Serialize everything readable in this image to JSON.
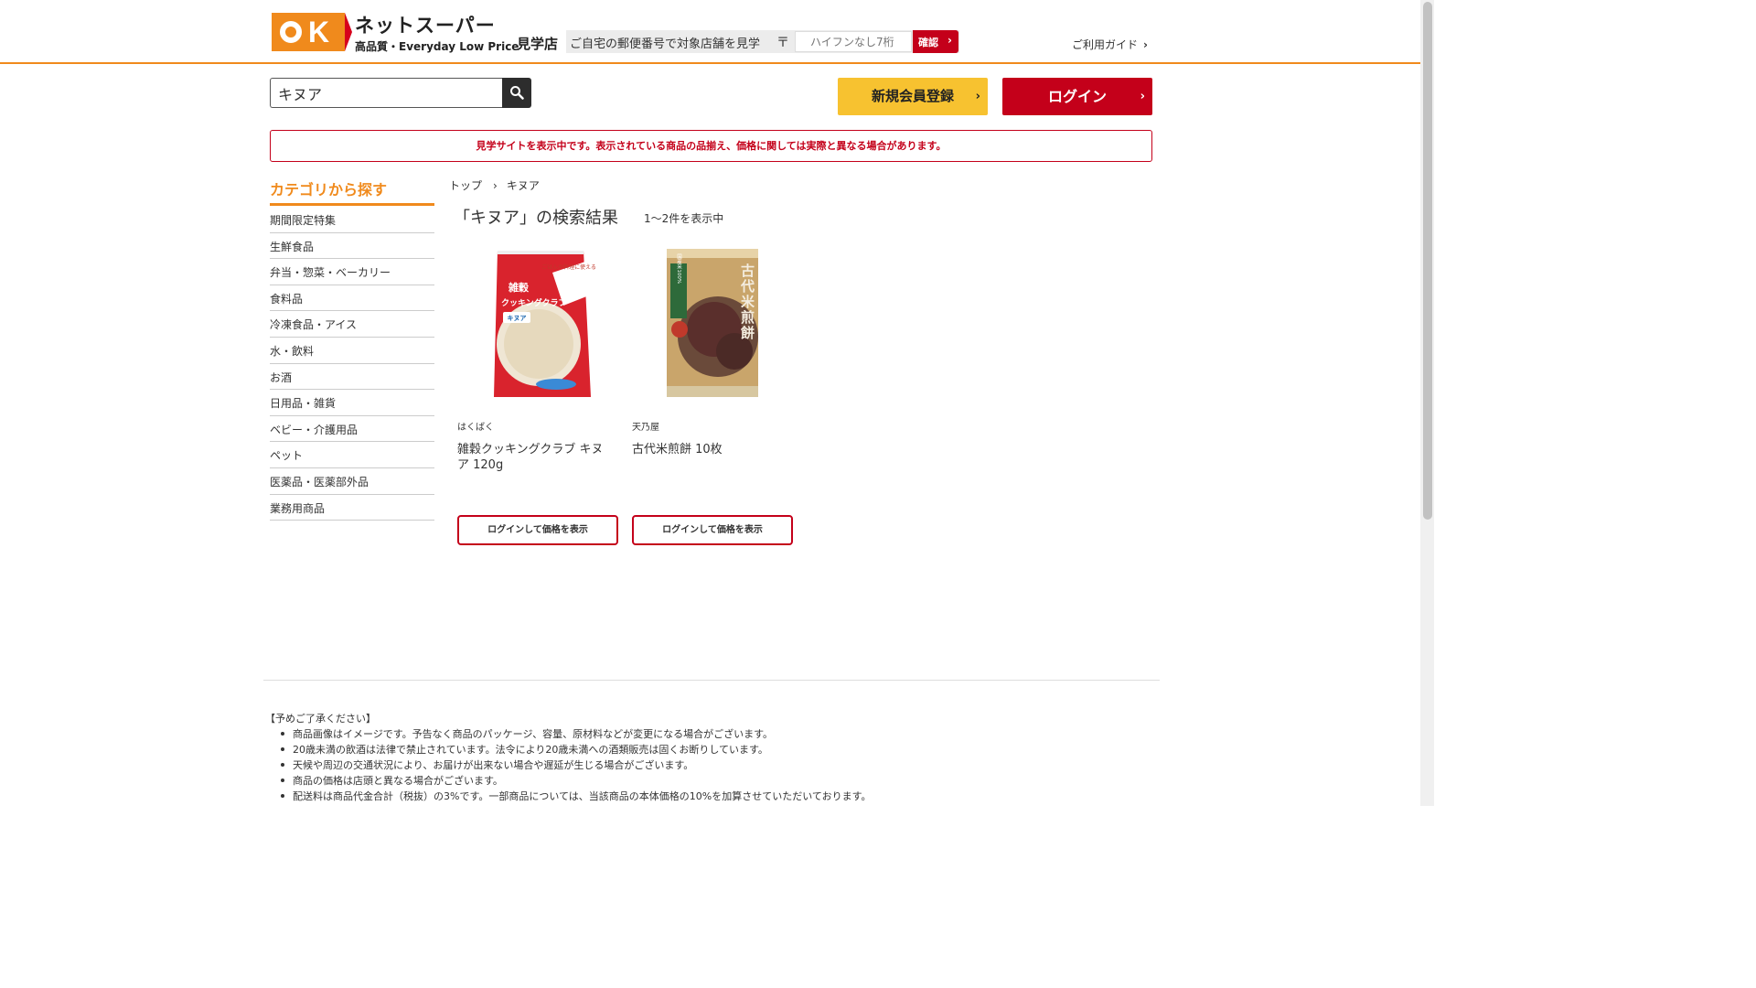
{
  "header": {
    "brand_title": "ネットスーパー",
    "brand_sub": "高品質・Everyday Low Price",
    "store_label": "見学店",
    "zip_prompt": "ご自宅の郵便番号で対象店舗を見学",
    "zip_mark": "〒",
    "zip_placeholder": "ハイフンなし7桁",
    "zip_button": "確認",
    "guide_link": "ご利用ガイド"
  },
  "search": {
    "value": "キヌア"
  },
  "buttons": {
    "register": "新規会員登録",
    "login": "ログイン"
  },
  "notice": "見学サイトを表示中です。表示されている商品の品揃え、価格に関しては実際と異なる場合があります。",
  "sidebar": {
    "title": "カテゴリから探す",
    "items": [
      "期間限定特集",
      "生鮮食品",
      "弁当・惣菜・ベーカリー",
      "食料品",
      "冷凍食品・アイス",
      "水・飲料",
      "お酒",
      "日用品・雑貨",
      "ベビー・介護用品",
      "ペット",
      "医薬品・医薬部外品",
      "業務用商品"
    ]
  },
  "breadcrumb": {
    "home": "トップ",
    "sep": "›",
    "current": "キヌア"
  },
  "results": {
    "title": "「キヌア」の検索結果",
    "count": "1〜2件を表示中"
  },
  "products": [
    {
      "maker": "はくばく",
      "name": "雑穀クッキングクラブ キヌア 120g",
      "price_button": "ログインして価格を表示",
      "pkg_small": "ごはんや料理に使える",
      "pkg_title1": "雑穀",
      "pkg_title2": "クッキングクラブ",
      "pkg_label": "キヌア"
    },
    {
      "maker": "天乃屋",
      "name": "古代米煎餅 10枚",
      "price_button": "ログインして価格を表示",
      "pkg_title": "古代米煎餅",
      "pkg_badge": "国産米100%"
    }
  ],
  "footer": {
    "heading": "【予めご了承ください】",
    "notes": [
      "商品画像はイメージです。予告なく商品のパッケージ、容量、原材料などが変更になる場合がございます。",
      "20歳未満の飲酒は法律で禁止されています。法令により20歳未満への酒類販売は固くお断りしています。",
      "天候や周辺の交通状況により、お届けが出来ない場合や遅延が生じる場合がございます。",
      "商品の価格は店頭と異なる場合がございます。",
      "配送料は商品代金合計（税抜）の3%です。一部商品については、当該商品の本体価格の10%を加算させていただいております。"
    ]
  },
  "colors": {
    "brand_orange": "#f08a1c",
    "brand_red": "#c4001a",
    "register_yellow": "#f7c230"
  }
}
